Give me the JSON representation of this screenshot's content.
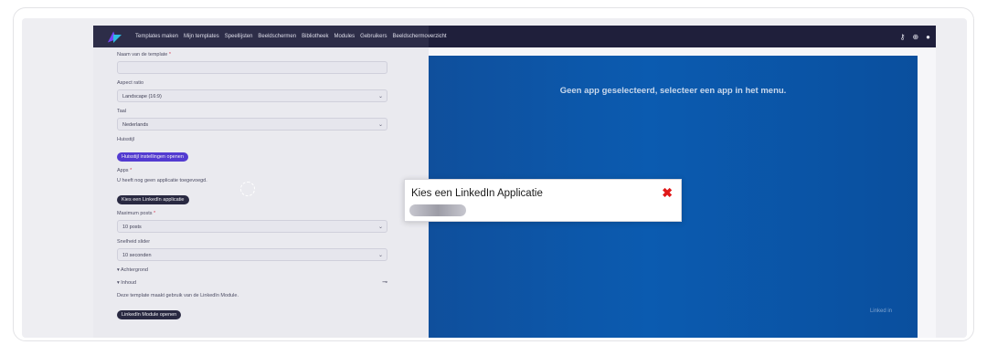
{
  "nav": {
    "items": [
      "Templates maken",
      "Mijn templates",
      "Speellijsten",
      "Beeldschermen",
      "Bibliotheek",
      "Modules",
      "Gebruikers",
      "Beeldschermoverzicht"
    ]
  },
  "form": {
    "name_label": "Naam van de template",
    "name_value": "",
    "aspect_label": "Aspect ratio",
    "aspect_value": "Landscape (16:9)",
    "lang_label": "Taal",
    "lang_value": "Nederlands",
    "style_label": "Huisstijl",
    "style_button": "Huisstijl instellingen openen",
    "apps_label": "Apps",
    "apps_empty": "U heeft nog geen applicatie toegevoegd.",
    "apps_button": "Kies een LinkedIn applicatie",
    "max_label": "Maximum posts",
    "max_value": "10 posts",
    "speed_label": "Snelheid slider",
    "speed_value": "10 seconden",
    "background_toggle": "Achtergrond",
    "content_toggle": "Inhoud",
    "module_text": "Deze template maakt gebruik van de LinkedIn Module.",
    "module_button": "LinkedIn Module openen",
    "required_mark": "*"
  },
  "preview": {
    "message": "Geen app geselecteerd, selecteer een app in het menu.",
    "brand": "Linked in"
  },
  "modal": {
    "title": "Kies een LinkedIn Applicatie",
    "close": "✖"
  },
  "colors": {
    "accent": "#4b2fd6",
    "topbar": "#1f1f3b",
    "preview_blue": "#0b5bb0",
    "close_red": "#e01818"
  }
}
